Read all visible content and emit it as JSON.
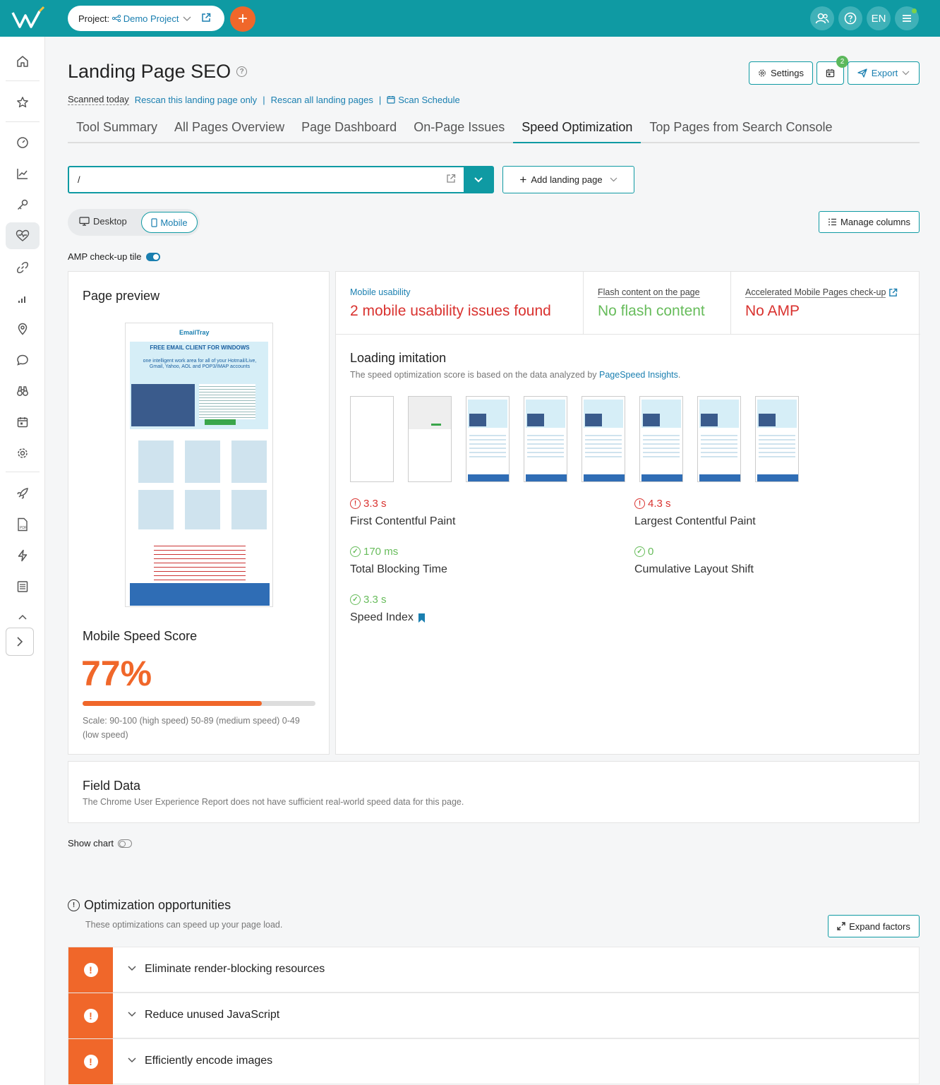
{
  "header": {
    "project_label": "Project:",
    "project_name": "Demo Project",
    "lang": "EN"
  },
  "page": {
    "title": "Landing Page SEO",
    "settings_label": "Settings",
    "calendar_badge": "2",
    "export_label": "Export"
  },
  "scan": {
    "scanned": "Scanned today",
    "rescan_one": "Rescan this landing page only",
    "sep": "|",
    "rescan_all": "Rescan all landing pages",
    "schedule": "Scan Schedule"
  },
  "tabs": [
    {
      "label": "Tool Summary"
    },
    {
      "label": "All Pages Overview"
    },
    {
      "label": "Page Dashboard"
    },
    {
      "label": "On-Page Issues"
    },
    {
      "label": "Speed Optimization"
    },
    {
      "label": "Top Pages from Search Console"
    }
  ],
  "url_selector": {
    "value": "/"
  },
  "add_landing_page": "Add landing page",
  "device": {
    "desktop": "Desktop",
    "mobile": "Mobile",
    "selected": "Mobile"
  },
  "manage_columns": "Manage columns",
  "amp_tile": {
    "label": "AMP check-up tile",
    "on": true
  },
  "preview": {
    "title": "Page preview",
    "speed_title": "Mobile Speed Score",
    "speed_value": "77%",
    "speed_fraction": 0.77,
    "scale_text": "Scale: 90-100 (high speed) 50-89 (medium speed) 0-49 (low speed)"
  },
  "usability": {
    "mobile_label": "Mobile usability",
    "mobile_value": "2 mobile usability issues found",
    "flash_label": "Flash content on the page",
    "flash_value": "No flash content",
    "amp_label": "Accelerated Mobile Pages check-up",
    "amp_value": "No AMP"
  },
  "loading": {
    "title": "Loading imitation",
    "desc": "The speed optimization score is based on the data analyzed by",
    "desc_link": "PageSpeed Insights",
    "desc_end": "."
  },
  "metrics": {
    "fcp": {
      "value": "3.3 s",
      "name": "First Contentful Paint"
    },
    "lcp": {
      "value": "4.3 s",
      "name": "Largest Contentful Paint"
    },
    "tbt": {
      "value": "170 ms",
      "name": "Total Blocking Time"
    },
    "cls": {
      "value": "0",
      "name": "Cumulative Layout Shift"
    },
    "si": {
      "value": "3.3 s",
      "name": "Speed Index"
    }
  },
  "field_data": {
    "title": "Field Data",
    "desc": "The Chrome User Experience Report does not have sufficient real-world speed data for this page."
  },
  "show_chart": {
    "label": "Show chart",
    "on": false
  },
  "optimization": {
    "title": "Optimization opportunities",
    "desc": "These optimizations can speed up your page load.",
    "expand_label": "Expand factors",
    "items": [
      {
        "label": "Eliminate render-blocking resources"
      },
      {
        "label": "Reduce unused JavaScript"
      },
      {
        "label": "Efficiently encode images"
      }
    ]
  },
  "phone_preview": {
    "brand": "EmailTray",
    "headline": "FREE EMAIL CLIENT FOR WINDOWS",
    "subline": "one intelligent work area for all of your Hotmail/Live, Gmail, Yahoo, AOL and POP3/IMAP accounts"
  },
  "colors": {
    "brand": "#0f9aa3",
    "accent": "#f0672a",
    "error": "#d9322f",
    "good": "#67bc5b",
    "link": "#1a7fb0"
  }
}
